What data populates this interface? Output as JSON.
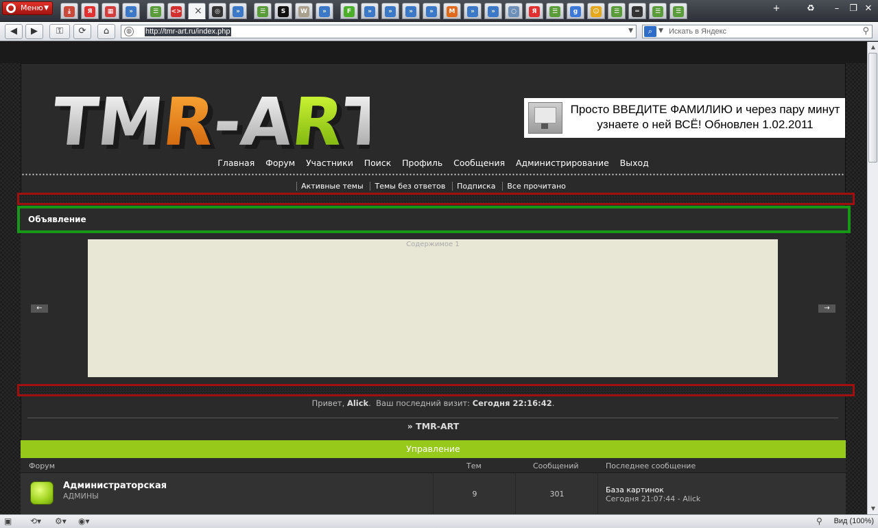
{
  "browser": {
    "menu_label": "Меню",
    "tabs": [
      {
        "icon": "download-icon",
        "color": "#c94a3a",
        "glyph": "⤓"
      },
      {
        "icon": "yandex-icon",
        "color": "#e03030",
        "glyph": "Я"
      },
      {
        "icon": "calendar-icon",
        "color": "#d23c3c",
        "glyph": "▦"
      },
      {
        "icon": "speed-dial-icon",
        "color": "#3b78c7",
        "glyph": "»"
      },
      {
        "icon": "page-icon",
        "color": "#5a9c3a",
        "glyph": "☰"
      },
      {
        "icon": "code-icon",
        "color": "#d42f2f",
        "glyph": "<>"
      },
      {
        "icon": "close-tab-icon",
        "color": "#888888",
        "glyph": "×"
      },
      {
        "icon": "disc-icon",
        "color": "#333333",
        "glyph": "◎"
      },
      {
        "icon": "speed-dial-icon",
        "color": "#3b78c7",
        "glyph": "»"
      },
      {
        "icon": "page-icon",
        "color": "#5a9c3a",
        "glyph": "☰"
      },
      {
        "icon": "s-icon",
        "color": "#111111",
        "glyph": "S"
      },
      {
        "icon": "websurf-icon",
        "color": "#a8a08c",
        "glyph": "W"
      },
      {
        "icon": "speed-dial-icon",
        "color": "#3b78c7",
        "glyph": "»"
      },
      {
        "icon": "f-icon",
        "color": "#4caf2a",
        "glyph": "F"
      },
      {
        "icon": "speed-dial-icon",
        "color": "#3b78c7",
        "glyph": "»"
      },
      {
        "icon": "speed-dial-icon",
        "color": "#3b78c7",
        "glyph": "»"
      },
      {
        "icon": "speed-dial-icon",
        "color": "#3b78c7",
        "glyph": "»"
      },
      {
        "icon": "speed-dial-icon",
        "color": "#3b78c7",
        "glyph": "»"
      },
      {
        "icon": "m-icon",
        "color": "#e06a1a",
        "glyph": "M"
      },
      {
        "icon": "speed-dial-icon",
        "color": "#3b78c7",
        "glyph": "»"
      },
      {
        "icon": "speed-dial-icon",
        "color": "#3b78c7",
        "glyph": "»"
      },
      {
        "icon": "blank-icon",
        "color": "#6d8fb8",
        "glyph": "○"
      },
      {
        "icon": "yandex-icon",
        "color": "#e03030",
        "glyph": "Я"
      },
      {
        "icon": "page-icon",
        "color": "#5a9c3a",
        "glyph": "☰"
      },
      {
        "icon": "google-icon",
        "color": "#3c78d8",
        "glyph": "g"
      },
      {
        "icon": "smiley-icon",
        "color": "#e5a81a",
        "glyph": "☺"
      },
      {
        "icon": "page-icon",
        "color": "#5a9c3a",
        "glyph": "☰"
      },
      {
        "icon": "bookmark-icon",
        "color": "#333333",
        "glyph": "═"
      },
      {
        "icon": "page-icon",
        "color": "#5a9c3a",
        "glyph": "☰"
      },
      {
        "icon": "page-icon",
        "color": "#5a9c3a",
        "glyph": "☰"
      }
    ],
    "active_tab_index": 6,
    "url": "http://tmr-art.ru/index.php",
    "search_placeholder": "Искать в Яндекс"
  },
  "site": {
    "logo_parts": [
      "TM",
      "R",
      "-A",
      "R",
      "T"
    ],
    "banner_text": "Просто ВВЕДИТЕ ФАМИЛИЮ и через пару минут узнаете о ней ВСЁ! Обновлен 1.02.2011",
    "main_nav": [
      "Главная",
      "Форум",
      "Участники",
      "Поиск",
      "Профиль",
      "Сообщения",
      "Администрирование",
      "Выход"
    ],
    "sub_nav": [
      "Активные темы",
      "Темы без ответов",
      "Подписка",
      "Все прочитано"
    ],
    "announcement_title": "Объявление",
    "slide_label": "Содержимое 1",
    "slide_prev": "←",
    "slide_next": "→",
    "greeting_prefix": "Привет,",
    "user": "Alick",
    "last_visit_label": "Ваш последний визит:",
    "last_visit_value": "Сегодня 22:16:42",
    "breadcrumb": "» TMR-ART",
    "category_title": "Управление",
    "table_headers": {
      "forum": "Форум",
      "topics": "Тем",
      "posts": "Сообщений",
      "last_post": "Последнее сообщение"
    },
    "forum": {
      "name": "Администраторская",
      "description": "АДМИНЫ",
      "topics": "9",
      "posts": "301",
      "last_post_title": "База картинок",
      "last_post_meta": "Сегодня 21:07:44 - Alick"
    }
  },
  "statusbar": {
    "zoom_label": "Вид (100%)"
  },
  "colors": {
    "accent_green": "#96c91a",
    "frame_red": "#a10f0f",
    "frame_green": "#179917"
  }
}
